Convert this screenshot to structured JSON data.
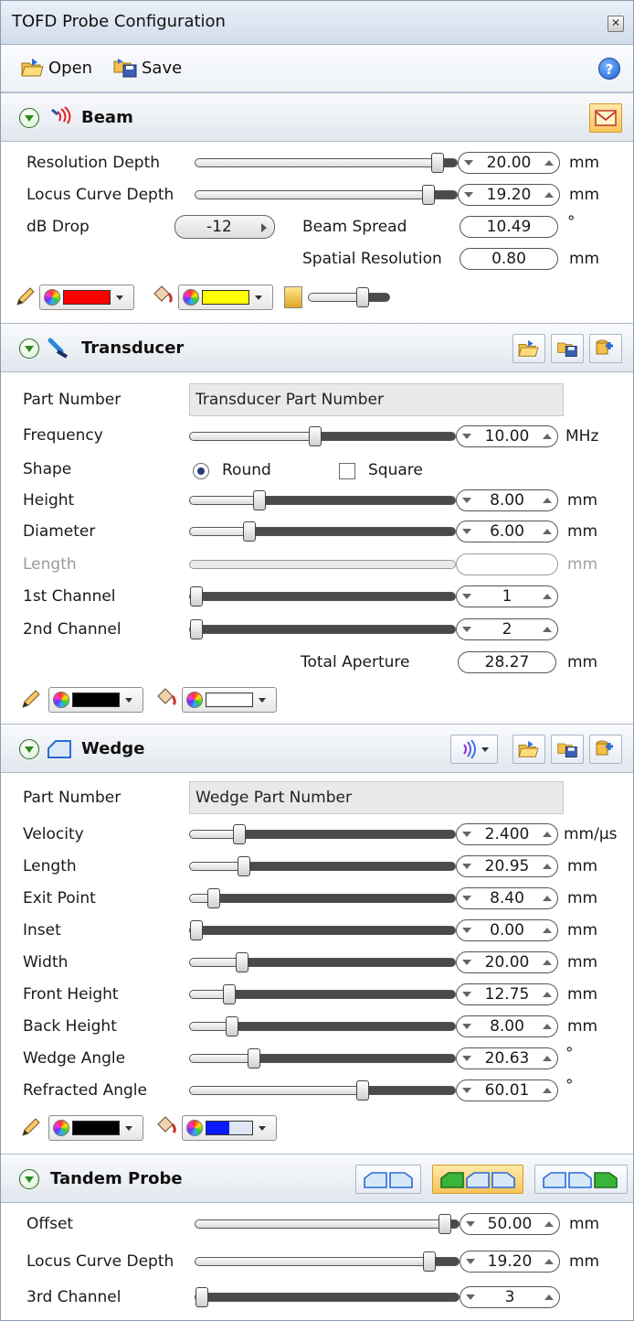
{
  "window": {
    "title": "TOFD Probe Configuration",
    "close_glyph": "✕"
  },
  "toolbar": {
    "open_label": "Open",
    "save_label": "Save",
    "help_glyph": "?"
  },
  "beam": {
    "title": "Beam",
    "resolution_depth": {
      "label": "Resolution Depth",
      "value": "20.00",
      "unit": "mm",
      "level": 0.95
    },
    "locus_curve_depth": {
      "label": "Locus Curve Depth",
      "value": "19.20",
      "unit": "mm",
      "level": 0.91
    },
    "db_drop": {
      "label": "dB Drop",
      "value": "-12"
    },
    "beam_spread": {
      "label": "Beam Spread",
      "value": "10.49",
      "unit": "°"
    },
    "spatial_resolution": {
      "label": "Spatial Resolution",
      "value": "0.80",
      "unit": "mm"
    },
    "line_color": "#ff0000",
    "fill_color": "#ffff00",
    "opacity_level": 0.7
  },
  "transducer": {
    "title": "Transducer",
    "part_number": {
      "label": "Part Number",
      "value": "Transducer Part Number"
    },
    "frequency": {
      "label": "Frequency",
      "value": "10.00",
      "unit": "MHz",
      "level": 0.47
    },
    "shape": {
      "label": "Shape",
      "round": "Round",
      "square": "Square",
      "selected": "Round"
    },
    "height": {
      "label": "Height",
      "value": "8.00",
      "unit": "mm",
      "level": 0.25
    },
    "diameter": {
      "label": "Diameter",
      "value": "6.00",
      "unit": "mm",
      "level": 0.21
    },
    "length": {
      "label": "Length",
      "value": "",
      "unit": "mm"
    },
    "channel1": {
      "label": "1st Channel",
      "value": "1",
      "level": 0.0
    },
    "channel2": {
      "label": "2nd Channel",
      "value": "2",
      "level": 0.0
    },
    "total_aperture": {
      "label": "Total Aperture",
      "value": "28.27",
      "unit": "mm"
    },
    "line_color": "#000000",
    "fill_color": "#ffffff"
  },
  "wedge": {
    "title": "Wedge",
    "part_number": {
      "label": "Part Number",
      "value": "Wedge Part Number"
    },
    "velocity": {
      "label": "Velocity",
      "value": "2.400",
      "unit": "mm/μs",
      "level": 0.17
    },
    "length": {
      "label": "Length",
      "value": "20.95",
      "unit": "mm",
      "level": 0.19
    },
    "exit_point": {
      "label": "Exit Point",
      "value": "8.40",
      "unit": "mm",
      "level": 0.07
    },
    "inset": {
      "label": "Inset",
      "value": "0.00",
      "unit": "mm",
      "level": 0.0
    },
    "width": {
      "label": "Width",
      "value": "20.00",
      "unit": "mm",
      "level": 0.18
    },
    "front_height": {
      "label": "Front Height",
      "value": "12.75",
      "unit": "mm",
      "level": 0.13
    },
    "back_height": {
      "label": "Back Height",
      "value": "8.00",
      "unit": "mm",
      "level": 0.14
    },
    "wedge_angle": {
      "label": "Wedge Angle",
      "value": "20.63",
      "unit": "°",
      "level": 0.23
    },
    "refracted_angle": {
      "label": "Refracted Angle",
      "value": "60.01",
      "unit": "°",
      "level": 0.66
    },
    "line_color": "#000000",
    "fill_color": "#0a1cff"
  },
  "tandem": {
    "title": "Tandem Probe",
    "offset": {
      "label": "Offset",
      "value": "50.00",
      "unit": "mm",
      "level": 0.97
    },
    "locus_curve_depth": {
      "label": "Locus Curve Depth",
      "value": "19.20",
      "unit": "mm",
      "level": 0.91
    },
    "channel3": {
      "label": "3rd Channel",
      "value": "3",
      "level": 0.0
    }
  }
}
